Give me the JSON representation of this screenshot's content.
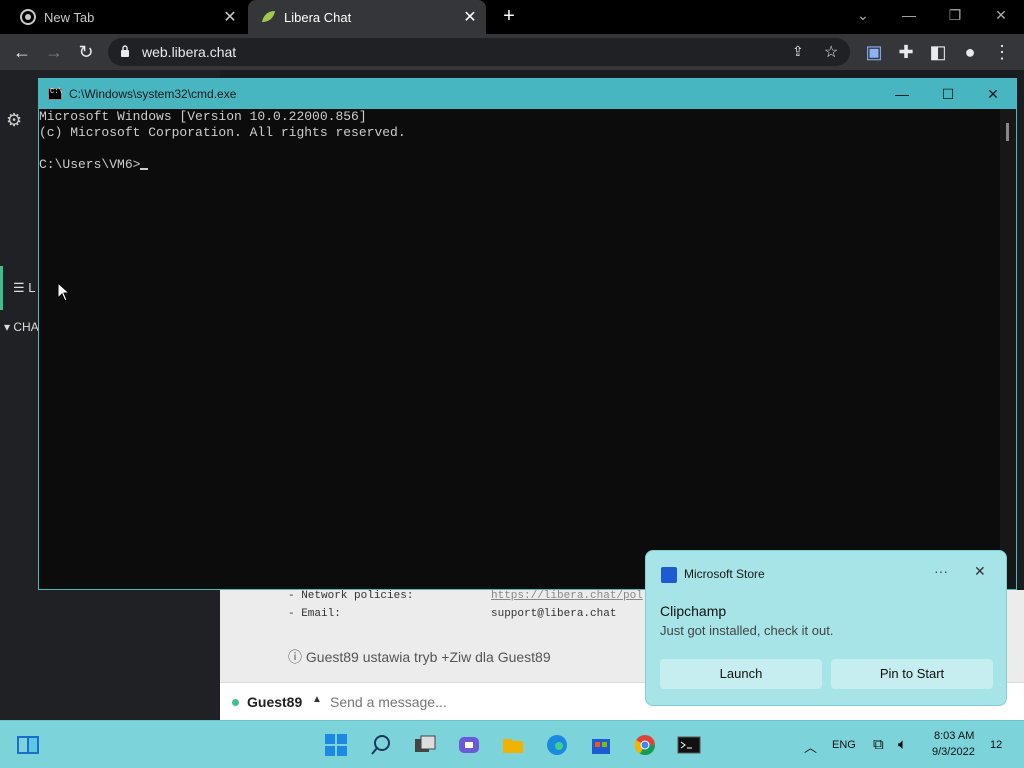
{
  "browser": {
    "tabs": [
      {
        "title": "New Tab",
        "active": false
      },
      {
        "title": "Libera Chat",
        "active": true
      }
    ],
    "url": "web.libera.chat"
  },
  "libera": {
    "sidebar": {
      "list_label": "L",
      "channels_header": "CHA"
    },
    "motd_rows": [
      {
        "key": "- Network policies:",
        "value": "https://libera.chat/pol"
      },
      {
        "key": "- Email:",
        "value": "support@libera.chat"
      }
    ],
    "status_line": "ⓘ Guest89 ustawia tryb +Ziw dla Guest89",
    "nick": "Guest89",
    "message_placeholder": "Send a message..."
  },
  "cmd": {
    "title": "C:\\Windows\\system32\\cmd.exe",
    "lines": [
      "Microsoft Windows [Version 10.0.22000.856]",
      "(c) Microsoft Corporation. All rights reserved.",
      "",
      "C:\\Users\\VM6>"
    ]
  },
  "toast": {
    "app": "Microsoft Store",
    "headline": "Clipchamp",
    "body": "Just got installed, check it out.",
    "launch_label": "Launch",
    "pin_label": "Pin to Start"
  },
  "taskbar": {
    "language": "ENG",
    "time": "8:03 AM",
    "date": "9/3/2022",
    "notification_count": "12"
  },
  "colors": {
    "cmd_title_bar": "#48b6c0",
    "taskbar": "#7dd3da",
    "toast": "#a6e4e8",
    "accent_green": "#3fbf8f"
  }
}
